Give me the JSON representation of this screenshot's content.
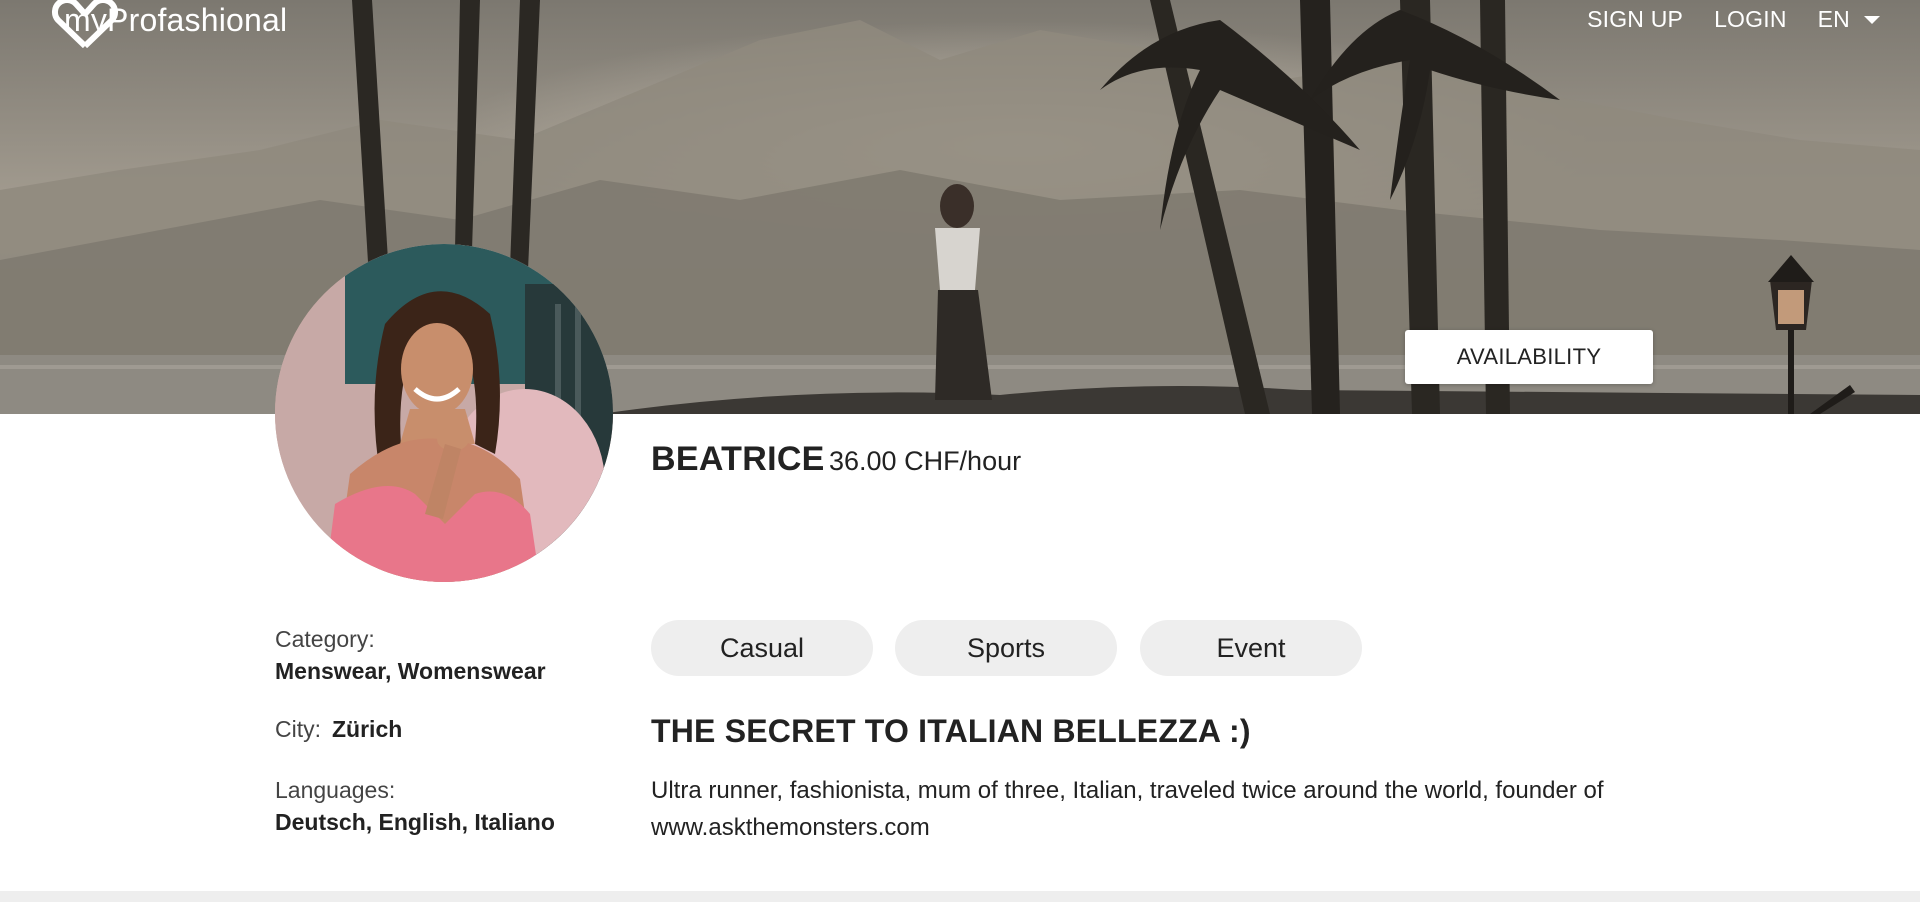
{
  "nav": {
    "logo_icon": "hearts-logo-icon",
    "brand": "myProfashional",
    "sign_up": "SIGN UP",
    "login": "LOGIN",
    "language": "EN"
  },
  "hero": {
    "availability_label": "AVAILABILITY"
  },
  "profile": {
    "name": "BEATRICE",
    "rate": "36.00 CHF/hour",
    "category_label": "Category:",
    "category_value": "Menswear, Womenswear",
    "city_label": "City:",
    "city_value": "Zürich",
    "languages_label": "Languages:",
    "languages_value": "Deutsch, English, Italiano",
    "tags": [
      "Casual",
      "Sports",
      "Event"
    ],
    "headline": "THE SECRET TO ITALIAN BELLEZZA :)",
    "bio_line1": "Ultra runner, fashionista, mum of three, Italian, traveled twice around the world, founder of",
    "bio_line2": "www.askthemonsters.com"
  },
  "colors": {
    "accent_bg": "#eeeeee",
    "text": "#222222",
    "nav_text": "#ffffff"
  }
}
